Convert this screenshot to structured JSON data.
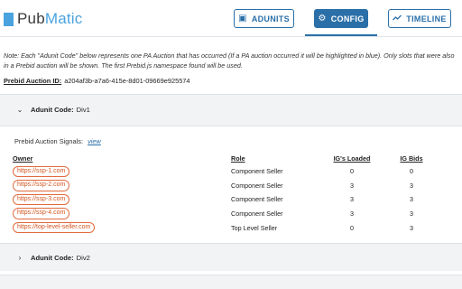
{
  "header": {
    "logo_part1": "Pub",
    "logo_part2": "Matic",
    "nav": {
      "adunits": {
        "label": "ADUNITS",
        "icon": "window-icon"
      },
      "config": {
        "label": "CONFIG",
        "icon": "gear-icon",
        "active": true
      },
      "timeline": {
        "label": "TIMELINE",
        "icon": "trend-icon"
      }
    }
  },
  "note": "Note: Each \"Adunit Code\" below represents one PA Auction that has occurred (If a PA auction occurred it will be highlighted in blue). Only slots that were also in a Prebid auction will be shown. The first Prebid.js namespace found will be used.",
  "auction": {
    "label": "Prebid Auction ID:",
    "id": "a204af3b-a7a6-415e-8d01-09669e925574"
  },
  "adunits": [
    {
      "label": "Adunit Code:",
      "code": "Div1",
      "expanded": true,
      "signals_label": "Prebid Auction Signals:",
      "signals_link": "view",
      "columns": {
        "owner": "Owner",
        "role": "Role",
        "ig_loaded": "IG's Loaded",
        "ig_bids": "IG Bids"
      },
      "rows": [
        {
          "owner": "https://ssp-1.com",
          "role": "Component Seller",
          "ig_loaded": "0",
          "ig_bids": "0"
        },
        {
          "owner": "https://ssp-2.com",
          "role": "Component Seller",
          "ig_loaded": "3",
          "ig_bids": "3"
        },
        {
          "owner": "https://ssp-3.com",
          "role": "Component Seller",
          "ig_loaded": "3",
          "ig_bids": "3"
        },
        {
          "owner": "https://ssp-4.com",
          "role": "Component Seller",
          "ig_loaded": "3",
          "ig_bids": "3"
        },
        {
          "owner": "https://top-level-seller.com",
          "role": "Top Level Seller",
          "ig_loaded": "0",
          "ig_bids": "3"
        }
      ]
    },
    {
      "label": "Adunit Code:",
      "code": "Div2",
      "expanded": false
    }
  ],
  "colors": {
    "accent": "#2a6fa8",
    "logo": "#4aa3df",
    "owner_pill": "#e26a3c"
  }
}
